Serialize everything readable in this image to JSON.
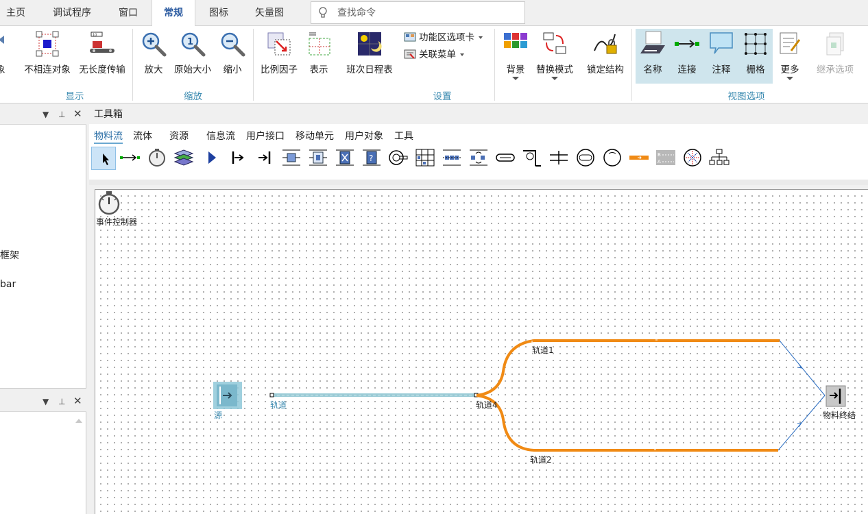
{
  "menu": {
    "tabs": [
      "主页",
      "调试程序",
      "窗口",
      "常规",
      "图标",
      "矢量图"
    ],
    "active_tab": "常规",
    "search_placeholder": "查找命令"
  },
  "ribbon": {
    "display": {
      "cut_label": "象",
      "unconnected_label": "不相连对象",
      "infinite_conveyor_label": "无长度传输",
      "group": "显示"
    },
    "zoom": {
      "zoom_in": "放大",
      "original": "原始大小",
      "zoom_out": "缩小",
      "group": "缩放"
    },
    "settings": {
      "scale_factor": "比例因子",
      "representation": "表示",
      "shift_calendar": "班次日程表",
      "ribbon_tab": "功能区选项卡",
      "context_menu": "关联菜单",
      "background": "背景",
      "replace_mode": "替换模式",
      "lock_structure": "锁定结构",
      "group": "设置"
    },
    "view": {
      "name": "名称",
      "connect": "连接",
      "comment": "注释",
      "grid": "栅格",
      "more": "更多",
      "inherit": "继承选项",
      "group": "视图选项"
    }
  },
  "left_panel": {
    "item1": "框架",
    "item2": "bar"
  },
  "toolbox": {
    "title": "工具箱",
    "tabs": [
      "物料流",
      "流体",
      "资源",
      "信息流",
      "用户接口",
      "移动单元",
      "用户对象",
      "工具"
    ],
    "active_tab": "物料流"
  },
  "canvas": {
    "event_controller": "事件控制器",
    "source": "源",
    "track": "轨道",
    "track1": "轨道1",
    "track2": "轨道2",
    "track4": "轨道4",
    "drain": "物料终结"
  },
  "colors": {
    "accent": "#3a8ab0",
    "track_orange": "#f08a14",
    "selected_teal": "#8fc8d8",
    "view_checked": "#cfe5ed"
  }
}
